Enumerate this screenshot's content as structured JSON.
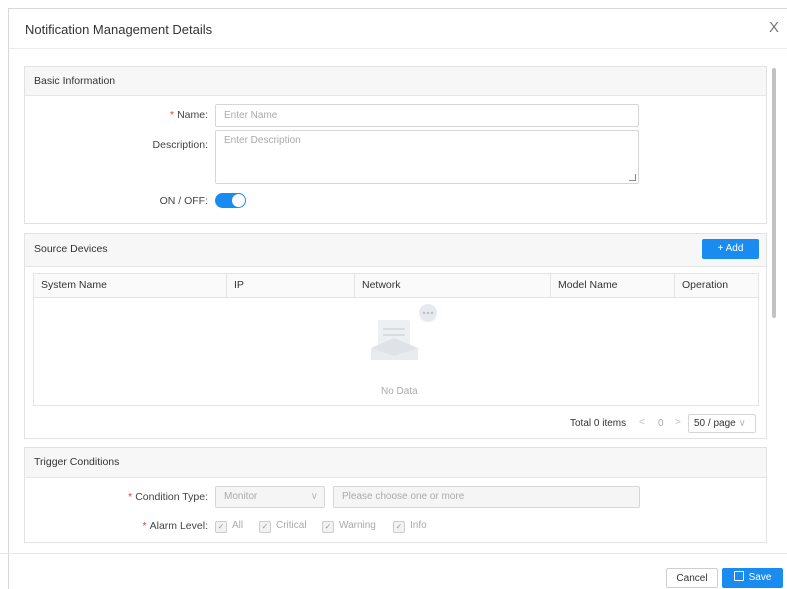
{
  "dialog": {
    "title": "Notification Management Details",
    "close_glyph": "X"
  },
  "basic_info": {
    "title": "Basic Information",
    "name_label": "Name",
    "name_placeholder": "Enter Name",
    "description_label": "Description",
    "description_placeholder": "Enter Description",
    "toggle_label": "ON / OFF:",
    "toggle_on": true
  },
  "source_devices": {
    "title": "Source Devices",
    "add_label": "+ Add",
    "columns": [
      "System Name",
      "IP",
      "Network",
      "Model Name",
      "Operation"
    ],
    "rows": [],
    "empty_text": "No Data",
    "pagination": {
      "total_label": "Total 0 items",
      "current_page": "0",
      "page_size": "50 / page"
    }
  },
  "trigger_conditions": {
    "title": "Trigger Conditions",
    "condition_type_label": "Condition Type",
    "condition_type_value": "Monitor",
    "condition_type_placeholder": "Please choose one or more",
    "alarm_level_label": "Alarm Level",
    "alarm_levels": [
      "All",
      "Critical",
      "Warning",
      "Info"
    ]
  },
  "footer": {
    "cancel_label": "Cancel",
    "save_label": "Save"
  },
  "colors": {
    "primary": "#1a8cf0",
    "required": "#e8412f"
  }
}
